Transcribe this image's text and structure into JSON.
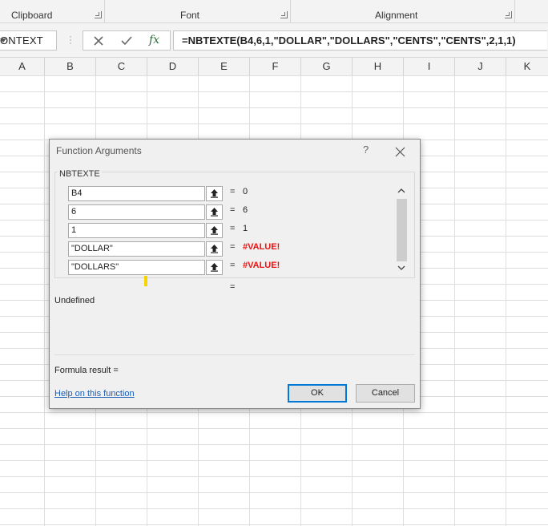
{
  "ribbon": {
    "groups": [
      {
        "label": "Clipboard"
      },
      {
        "label": "Font"
      },
      {
        "label": "Alignment"
      }
    ]
  },
  "formula_bar": {
    "name_box": "ONTEXT",
    "cancel_icon": "x-icon",
    "enter_icon": "check-icon",
    "fx_label": "fx",
    "formula": "=NBTEXTE(B4,6,1,\"DOLLAR\",\"DOLLARS\",\"CENTS\",\"CENTS\",2,1,1)"
  },
  "columns": [
    "A",
    "B",
    "C",
    "D",
    "E",
    "F",
    "G",
    "H",
    "I",
    "J",
    "K"
  ],
  "dialog": {
    "title": "Function Arguments",
    "help_glyph": "?",
    "close_glyph": "✕",
    "function_name": "NBTEXTE",
    "args": [
      {
        "value": "B4",
        "eq": "=",
        "result": "0",
        "error": false
      },
      {
        "value": "6",
        "eq": "=",
        "result": "6",
        "error": false
      },
      {
        "value": "1",
        "eq": "=",
        "result": "1",
        "error": false
      },
      {
        "value": "\"DOLLAR\"",
        "eq": "=",
        "result": "#VALUE!",
        "error": true
      },
      {
        "value": "\"DOLLARS\"",
        "eq": "=",
        "result": "#VALUE!",
        "error": true
      }
    ],
    "overall_eq": "=",
    "description": "Undefined",
    "formula_result": "Formula result =",
    "help_link": "Help on this function",
    "ok_label": "OK",
    "cancel_label": "Cancel"
  }
}
